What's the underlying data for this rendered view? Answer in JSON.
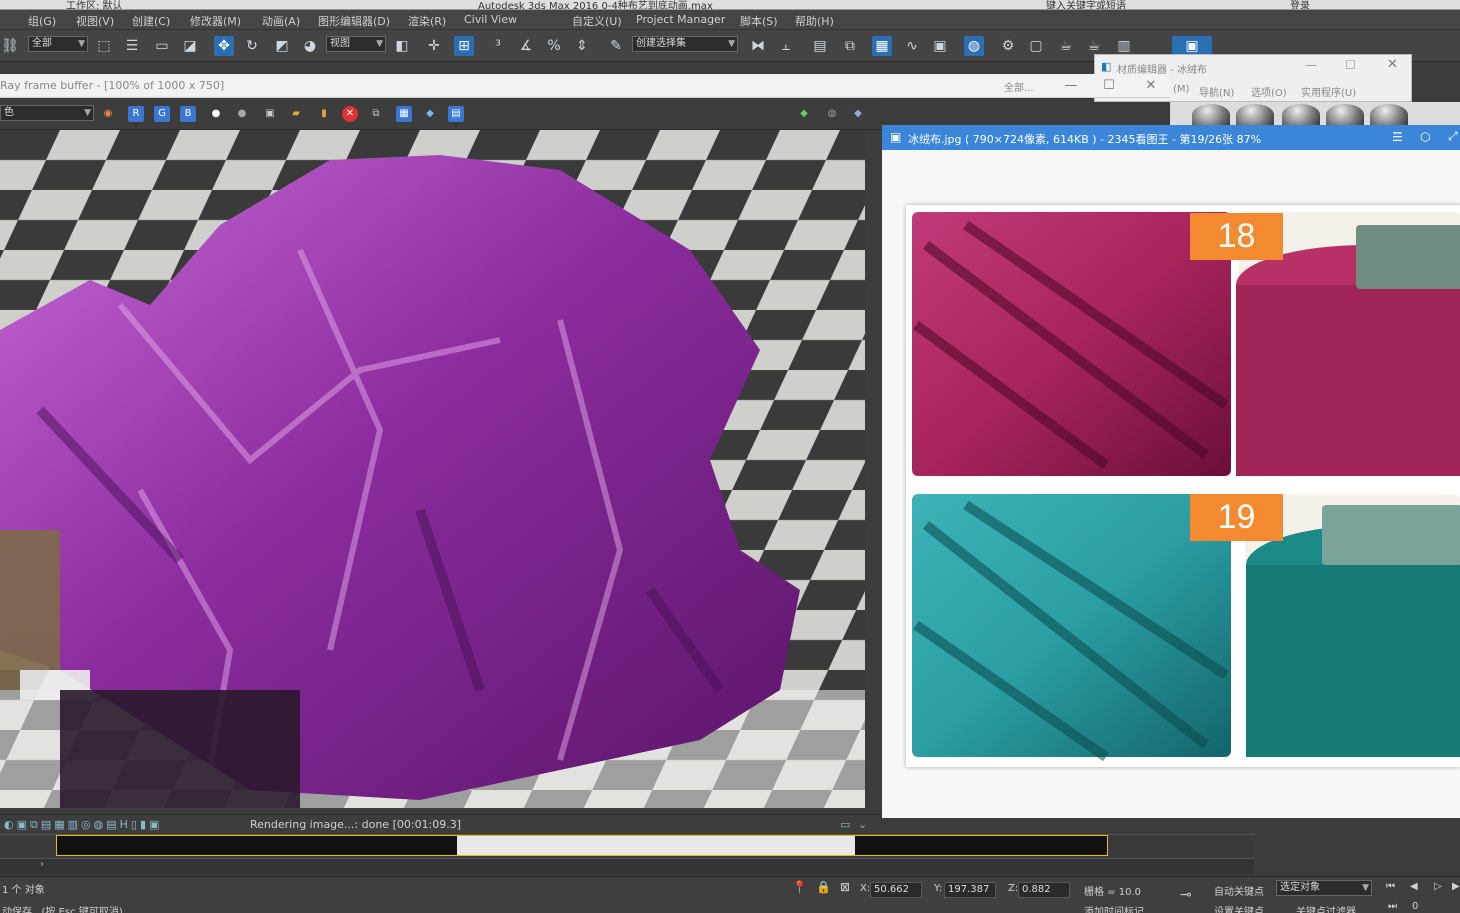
{
  "app": {
    "title": "Autodesk 3ds Max 2016    0-4种布艺到底动画.max",
    "workspace": "工作区: 默认",
    "search_placeholder": "键入关键字或短语",
    "login": "登录"
  },
  "menu": [
    "组(G)",
    "视图(V)",
    "创建(C)",
    "修改器(M)",
    "动画(A)",
    "图形编辑器(D)",
    "渲染(R)",
    "Civil View",
    "自定义(U)",
    "Project Manager",
    "脚本(S)",
    "帮助(H)"
  ],
  "toolbar": {
    "selection_filter": "全部",
    "ref_coord": "视图",
    "named_set": "创建选择集"
  },
  "frame_buffer": {
    "title": "Ray frame buffer - [100% of 1000 x 750]",
    "channel": "色",
    "status": "Rendering image...: done [00:01:09.3]",
    "extra": "全部..."
  },
  "material_editor": {
    "title": "材质编辑器 - 冰绒布",
    "menus": [
      "(M)",
      "导航(N)",
      "选项(O)",
      "实用程序(U)"
    ]
  },
  "image_viewer": {
    "title": "冰绒布.jpg ( 790×724像素, 614KB ) - 2345看图王 - 第19/26张 87%",
    "labels": [
      "18",
      "19"
    ],
    "colors": {
      "magenta": "#a8245c",
      "teal": "#2a9ea3"
    }
  },
  "status": {
    "selection": "1 个 对象",
    "hint": "动保存...(按 Esc 键可取消)",
    "x_label": "X:",
    "x": "50.662",
    "y_label": "Y:",
    "y": "197.387",
    "z_label": "Z:",
    "z": "0.882",
    "grid": "栅格 = 10.0",
    "auto_key": "自动关键点",
    "set_key": "设置关键点",
    "key_mode": "选定对象",
    "add_time_tag": "添加时间标记",
    "key_filter": "关键点过滤器...",
    "frame": "0"
  }
}
